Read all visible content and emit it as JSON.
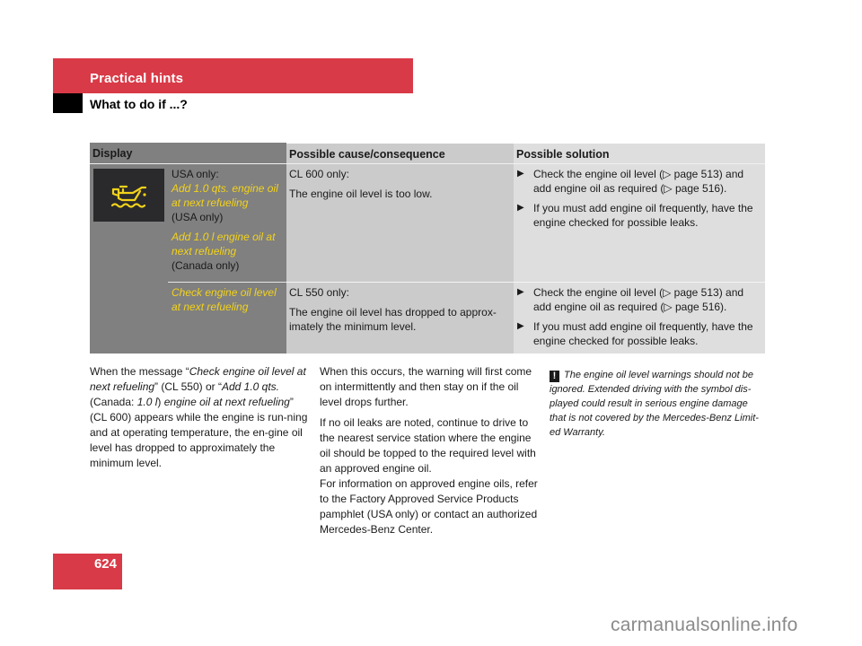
{
  "header": {
    "section": "Practical hints",
    "subsection": "What to do if ...?"
  },
  "table": {
    "columns": [
      "Display",
      "Possible cause/consequence",
      "Possible solution"
    ],
    "icon": "engine-oil-level-warning-icon",
    "rows": [
      {
        "display": {
          "prefix": "USA only:",
          "msg_usa": "Add 1.0 qts. engine oil at next refueling",
          "note_usa": "(USA only)",
          "msg_canada": "Add 1.0 l engine oil at next refueling",
          "note_canada": "(Canada only)"
        },
        "cause_title": "CL 600 only:",
        "cause_text": "The engine oil level is too low.",
        "solutions": [
          "Check the engine oil level (▷ page 513) and add engine oil as required (▷ page 516).",
          "If you must add engine oil frequently, have the engine checked for possible leaks."
        ]
      },
      {
        "display": {
          "msg": "Check engine oil level at next refueling"
        },
        "cause_title": "CL 550 only:",
        "cause_text": "The engine oil level has dropped to approx-imately the minimum level.",
        "solutions": [
          "Check the engine oil level (▷ page 513) and add engine oil as required (▷ page 516).",
          "If you must add engine oil frequently, have the engine checked for possible leaks."
        ]
      }
    ]
  },
  "body": {
    "col1": {
      "t1": "When the message “",
      "i1": "Check engine oil level at next refueling",
      "t2": "” (CL 550) or “",
      "i2": "Add 1.0 qts.",
      "t3": " (Canada: ",
      "i3": "1.0 l",
      "t4": ") ",
      "i4": "engine oil at next refueling",
      "t5": "” (CL 600) appears while the engine is run-ning and at operating temperature, the en-gine oil level has dropped to approximately the minimum level."
    },
    "col2": [
      "When this occurs, the warning will first come on intermittently and then stay on if the oil level drops further.",
      "If no oil leaks are noted, continue to drive to the nearest service station where the engine oil should be topped to the required level with an approved engine oil.",
      "For information on approved engine oils, refer to the Factory Approved Service Products pamphlet (USA only) or contact an authorized Mercedes-Benz Center."
    ],
    "warning": {
      "symbol": "!",
      "text": "The engine oil level warnings should not be ignored. Extended driving with the symbol dis-played could result in serious engine damage that is not covered by the Mercedes-Benz Limit-ed Warranty."
    }
  },
  "footer": {
    "page_number": "624",
    "watermark": "carmanualsonline.info"
  },
  "colors": {
    "accent_red": "#d93a47",
    "display_yellow": "#f2d21b"
  }
}
